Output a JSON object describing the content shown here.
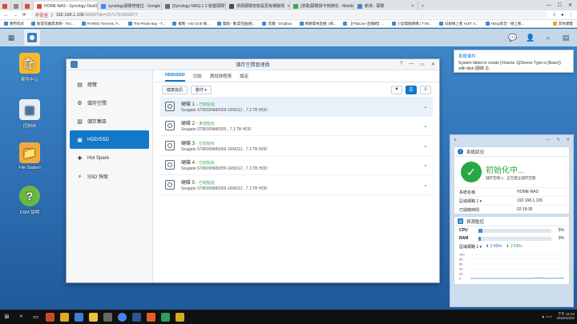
{
  "browser": {
    "tabs_small": [
      "",
      "",
      ""
    ],
    "tabs": [
      {
        "label": "HOME-NAS - Synology DiskStation",
        "color": "#d94a3a",
        "active": true
      },
      {
        "label": "synology硬碟修復位 - Google 搜尋",
        "color": "#4285f4",
        "active": false
      },
      {
        "label": "[Synology NAS] 1-2 裝置硬碟安裝",
        "color": "#6a6a6a",
        "active": false
      },
      {
        "label": "偵測硬碟安裝是否有被破壞",
        "color": "#4a4a4a",
        "active": false
      },
      {
        "label": "[求助]硬碟掛不到損化 - Mobile01",
        "color": "#3aa655",
        "active": false
      },
      {
        "label": "新增 - 硬碟",
        "color": "#4a86c6",
        "active": false
      }
    ],
    "address": {
      "warning": "不安全",
      "url": "192.168.1.106",
      "rest": ":5000/?dx=1571752962877"
    },
    "bookmarks": [
      "應用程式",
      "動漫花園資源網 - Tim...",
      "RARBG Torrents, F...",
      "The Pirate Bay - T...",
      "複製 - HD Club 檢...",
      "電腦 - 動漫花園(動...",
      "黑魔 - Dropbox",
      "網路電視直播 | 網...",
      "【PiliaLive 直播網】...",
      "小型電腦網購 | TVB...",
      "日劇線上看 HiJIT V...",
      "HDay影音 - 線上看..."
    ],
    "bookmarks_right": "其他書籤"
  },
  "desktop": {
    "icons": [
      {
        "label": "套件中心",
        "name": "package-center-icon"
      },
      {
        "label": "控制台",
        "name": "control-panel-icon"
      },
      {
        "label": "File Station",
        "name": "file-station-icon"
      },
      {
        "label": "DSM 說明",
        "name": "dsm-help-icon"
      }
    ]
  },
  "window": {
    "title": "儲存空間管理員",
    "sidebar": [
      {
        "label": "總覽",
        "icon": "overview-icon"
      },
      {
        "label": "儲存空間",
        "icon": "volume-icon"
      },
      {
        "label": "儲存集區",
        "icon": "storage-pool-icon"
      },
      {
        "label": "HDD/SSD",
        "icon": "hdd-icon",
        "active": true
      },
      {
        "label": "Hot Spare",
        "icon": "hot-spare-icon"
      },
      {
        "label": "SSD 快取",
        "icon": "ssd-cache-icon"
      }
    ],
    "tabs": [
      "HDD/SSD",
      "日誌",
      "測試排程表",
      "設定"
    ],
    "toolbar": {
      "health_info": "健康資訊",
      "action": "動作 ▾"
    },
    "disks": [
      {
        "name": "硬碟 1",
        "status": "- 已初始化",
        "model": "Seagate ST8000NM0055-1RM112 , 7.3 TB HDD"
      },
      {
        "name": "硬碟 2",
        "status": "- 未初始化",
        "model": "Seagate ST8000NM0055 , 7.3 TB HDD"
      },
      {
        "name": "硬碟 3",
        "status": "- 已初始化",
        "model": "Seagate ST8000NM0055-1RM112 , 7.3 TB HDD"
      },
      {
        "name": "硬碟 4",
        "status": "- 已初始化",
        "model": "Seagate ST8000NM0055-1RM112 , 7.3 TB HDD"
      },
      {
        "name": "硬碟 5",
        "status": "- 已初始化",
        "model": "Seagate ST8000NM0055-1RM112 , 7.3 TB HDD"
      }
    ]
  },
  "notification": {
    "title": "系統事件",
    "text": "System failed to create [Volume 1](Device Type is [Basic]) with disk [硬碟 2]."
  },
  "widgets": {
    "system_health": {
      "title": "系統狀況",
      "status": "初始化中...",
      "detail": "儲存空間 1：正在建立儲存空間",
      "rows": [
        {
          "k": "系統名稱",
          "v": "HOME-NAS"
        },
        {
          "k": "區域網路 1 ▾",
          "v": "192.168.1.106"
        },
        {
          "k": "已開機時間",
          "v": "02:18:39"
        }
      ]
    },
    "resource": {
      "title": "資源監控",
      "cpu_label": "CPU",
      "cpu": 5,
      "cpu_text": "5%",
      "ram_label": "RAM",
      "ram": 3,
      "ram_text": "3%",
      "net_label": "區域網路 1 ▾",
      "up": "⬆ 2 KB/s",
      "down": "⬇ 2 KB/s",
      "ticks": [
        "100",
        "80",
        "60",
        "40",
        "20",
        "0"
      ]
    }
  },
  "taskbar": {
    "time": "下午 11:04",
    "date": "2019/10/22"
  }
}
